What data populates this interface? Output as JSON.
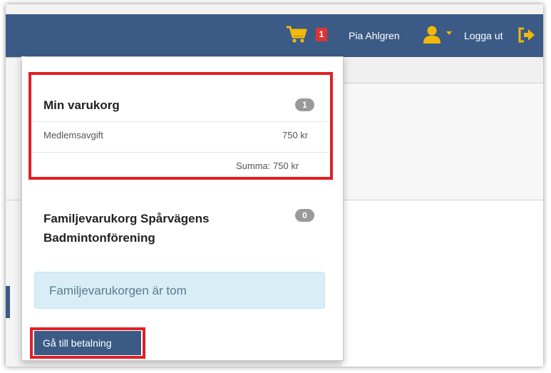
{
  "navbar": {
    "cart_icon": "shopping-cart-icon",
    "cart_count": "1",
    "user_name": "Pia Ahlgren",
    "user_icon": "user-icon",
    "logout_label": "Logga ut",
    "logout_icon": "sign-out-icon",
    "accent_color": "#f0b90b",
    "bar_color": "#3b5b86"
  },
  "dropdown": {
    "my_cart": {
      "title": "Min varukorg",
      "count": "1",
      "items": [
        {
          "name": "Medlemsavgift",
          "price": "750 kr"
        }
      ],
      "total": "Summa: 750 kr"
    },
    "family_cart": {
      "title_line1": "Familjevarukorg Spårvägens",
      "title_line2": "Badmintonförening",
      "count": "0",
      "empty_message": "Familjevarukorgen är tom"
    },
    "checkout_button": "Gå till betalning"
  }
}
